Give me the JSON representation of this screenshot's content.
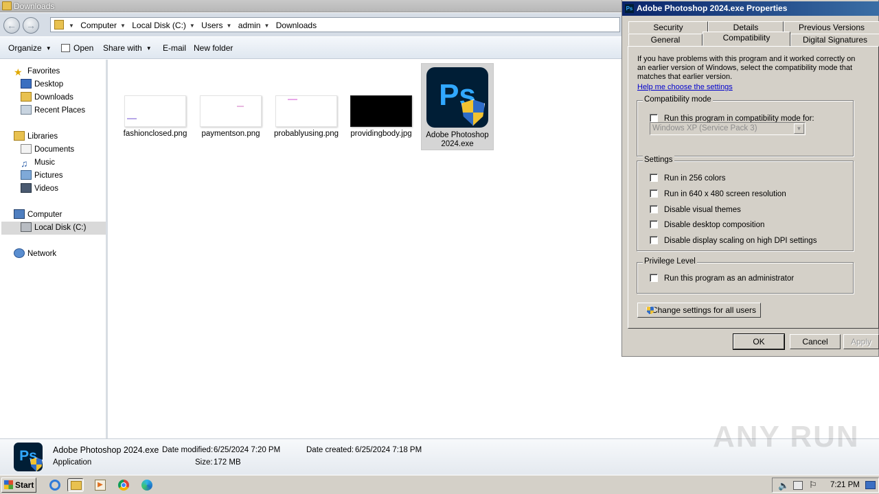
{
  "explorer": {
    "title": "Downloads",
    "breadcrumbs": [
      "Computer",
      "Local Disk (C:)",
      "Users",
      "admin",
      "Downloads"
    ],
    "toolbar": {
      "organize": "Organize",
      "open": "Open",
      "share_with": "Share with",
      "email": "E-mail",
      "new_folder": "New folder"
    },
    "nav": {
      "favorites": "Favorites",
      "desktop": "Desktop",
      "downloads": "Downloads",
      "recent_places": "Recent Places",
      "libraries": "Libraries",
      "documents": "Documents",
      "music": "Music",
      "pictures": "Pictures",
      "videos": "Videos",
      "computer": "Computer",
      "local_disk": "Local Disk (C:)",
      "network": "Network"
    },
    "files": [
      {
        "name": "fashionclosed.png"
      },
      {
        "name": "paymentson.png"
      },
      {
        "name": "probablyusing.png"
      },
      {
        "name": "providingbody.jpg"
      },
      {
        "name": "Adobe Photoshop 2024.exe",
        "selected": true
      }
    ],
    "details": {
      "name": "Adobe Photoshop 2024.exe",
      "type": "Application",
      "date_modified_label": "Date modified:",
      "date_modified": "6/25/2024 7:20 PM",
      "date_created_label": "Date created:",
      "date_created": "6/25/2024 7:18 PM",
      "size_label": "Size:",
      "size": "172 MB"
    }
  },
  "dialog": {
    "title": "Adobe Photoshop 2024.exe Properties",
    "tabs_row1": [
      "Security",
      "Details",
      "Previous Versions"
    ],
    "tabs_row2": [
      "General",
      "Compatibility",
      "Digital Signatures"
    ],
    "active_tab": "Compatibility",
    "intro": "If you have problems with this program and it worked correctly on an earlier version of Windows, select the compatibility mode that matches that earlier version.",
    "help_link": "Help me choose the settings",
    "compat_group": "Compatibility mode",
    "compat_check": "Run this program in compatibility mode for:",
    "compat_select": "Windows XP (Service Pack 3)",
    "settings_group": "Settings",
    "settings": [
      "Run in 256 colors",
      "Run in 640 x 480 screen resolution",
      "Disable visual themes",
      "Disable desktop composition",
      "Disable display scaling on high DPI settings"
    ],
    "privilege_group": "Privilege Level",
    "privilege_check": "Run this program as an administrator",
    "change_all_users": "Change settings for all users",
    "ok": "OK",
    "cancel": "Cancel",
    "apply": "Apply"
  },
  "taskbar": {
    "start": "Start",
    "clock": "7:21 PM"
  },
  "watermark": "ANY RUN",
  "colors": {
    "ps_background": "#001e36",
    "ps_text": "#31a8ff",
    "dialog_title": "#0a246a",
    "link": "#0000cc"
  }
}
